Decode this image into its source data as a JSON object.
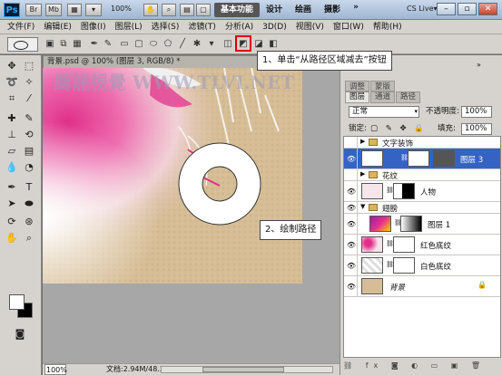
{
  "app": {
    "logo": "Ps",
    "titlebar_buttons": [
      "Br",
      "Mb"
    ],
    "zoom": "100%",
    "workspaces": [
      "基本功能",
      "设计",
      "绘画",
      "摄影"
    ],
    "workspace_more": "»",
    "cs_live": "CS Live▾"
  },
  "menu": [
    "文件(F)",
    "编辑(E)",
    "图像(I)",
    "图层(L)",
    "选择(S)",
    "滤镜(T)",
    "分析(A)",
    "3D(D)",
    "视图(V)",
    "窗口(W)",
    "帮助(H)"
  ],
  "document": {
    "tab_title": "背景.psd @ 100% (图层 3, RGB/8) *",
    "status_zoom": "100%",
    "doc_size": "文档:2.94M/48.2M",
    "watermark": "鹰龍視覺 WWW.TLVI.NET"
  },
  "callouts": {
    "step1": "1、单击“从路径区域减去”按钮",
    "step2": "2、绘制路径"
  },
  "panels": {
    "tabs_top": [
      "调整",
      "蒙版"
    ],
    "tabs": [
      "图层",
      "通道",
      "路径"
    ],
    "blend_mode": "正常",
    "opacity_label": "不透明度:",
    "opacity_value": "100%",
    "lock_label": "锁定:",
    "fill_label": "填充:",
    "fill_value": "100%",
    "layers": [
      {
        "name": "文字装饰",
        "type": "group",
        "visible": false
      },
      {
        "name": "图层 3",
        "type": "layer",
        "visible": true,
        "selected": true
      },
      {
        "name": "花纹",
        "type": "group",
        "visible": false
      },
      {
        "name": "人物",
        "type": "layer",
        "visible": true
      },
      {
        "name": "翅膀",
        "type": "group",
        "visible": true
      },
      {
        "name": "图层 1",
        "type": "layer",
        "visible": true
      },
      {
        "name": "红色底纹",
        "type": "layer",
        "visible": true
      },
      {
        "name": "白色底纹",
        "type": "layer",
        "visible": true
      },
      {
        "name": "背景",
        "type": "layer",
        "visible": true,
        "locked": true
      }
    ],
    "footer_icons": [
      "link-icon",
      "fx-icon",
      "mask-icon",
      "adjustment-icon",
      "folder-icon",
      "new-layer-icon",
      "trash-icon"
    ]
  },
  "colors": {
    "selected_layer": "#3563c4",
    "highlight": "#e00000"
  }
}
